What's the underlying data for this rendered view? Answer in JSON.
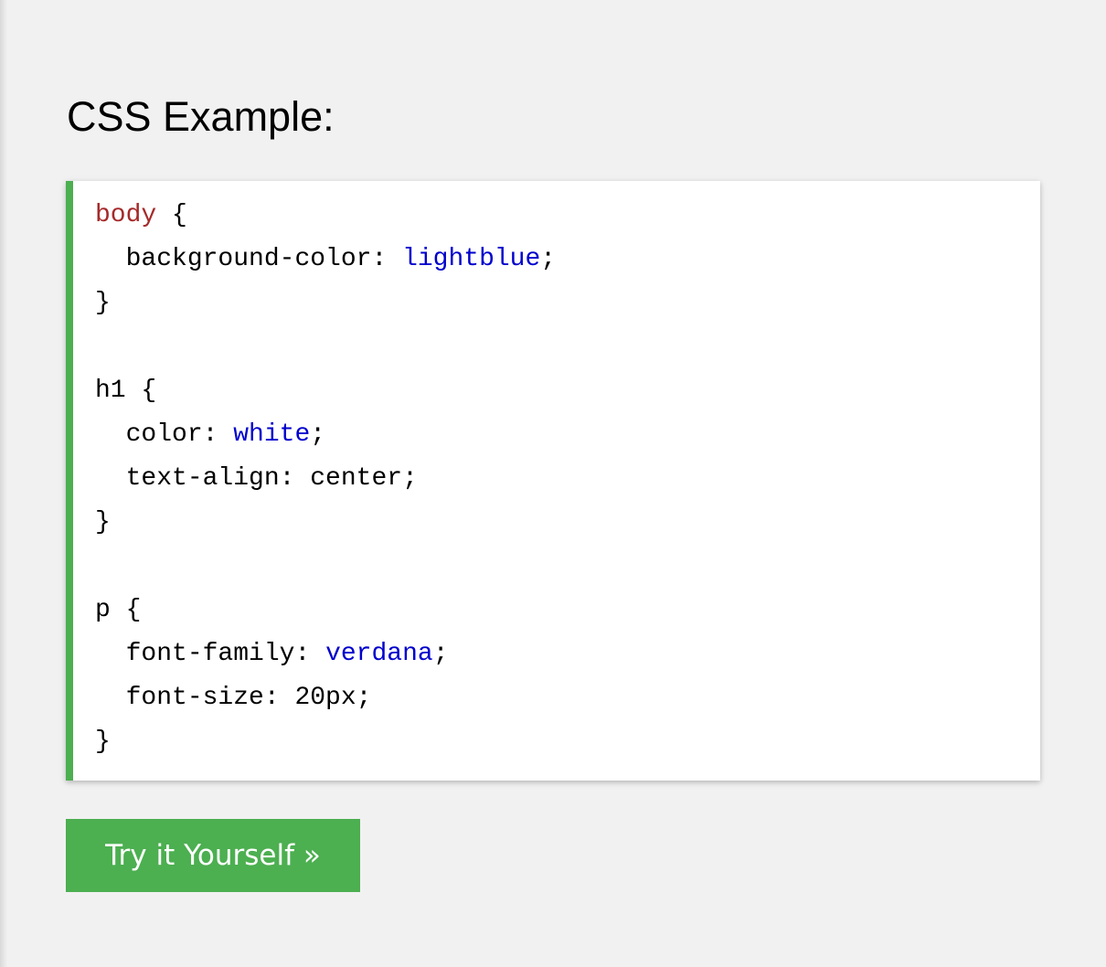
{
  "example": {
    "title": "CSS Example:",
    "button_label": "Try it Yourself »"
  },
  "code_lines": [
    {
      "selector": "body",
      "punct_open": " {"
    },
    {
      "indent": "  ",
      "property": "background-color",
      "sep": ": ",
      "value": "lightblue",
      "value_type": "keyword",
      "end": ";"
    },
    {
      "text": "}"
    },
    {
      "text": ""
    },
    {
      "selector_plain": "h1",
      "punct_open": " {"
    },
    {
      "indent": "  ",
      "property": "color",
      "sep": ": ",
      "value": "white",
      "value_type": "keyword",
      "end": ";"
    },
    {
      "indent": "  ",
      "property": "text-align",
      "sep": ": ",
      "value": "center",
      "value_type": "plain",
      "end": ";"
    },
    {
      "text": "}"
    },
    {
      "text": ""
    },
    {
      "selector_plain": "p",
      "punct_open": " {"
    },
    {
      "indent": "  ",
      "property": "font-family",
      "sep": ": ",
      "value": "verdana",
      "value_type": "keyword",
      "end": ";"
    },
    {
      "indent": "  ",
      "property": "font-size",
      "sep": ": ",
      "value": "20px",
      "value_type": "plain",
      "end": ";"
    },
    {
      "text": "}"
    }
  ],
  "colors": {
    "accent": "#4caf50",
    "selector": "#a52a2a",
    "keyword_value": "#0000cd",
    "background": "#f1f1f1"
  }
}
